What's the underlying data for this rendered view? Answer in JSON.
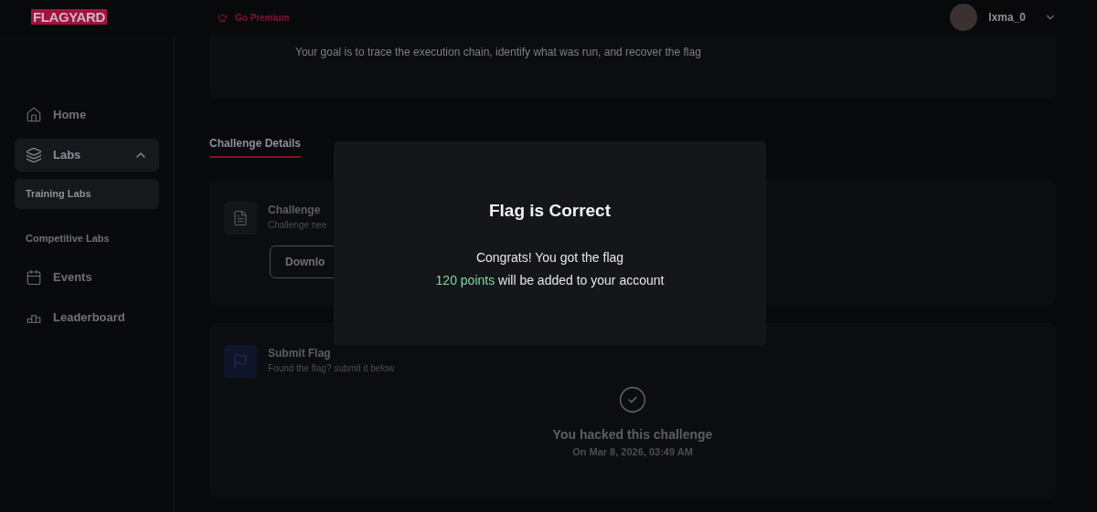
{
  "header": {
    "logo": "FLAGYARD",
    "premium": "Go Premium",
    "user": {
      "name": "lxma_0"
    }
  },
  "sidebar": {
    "items": [
      {
        "kind": "link",
        "label": "Home",
        "selected": false
      },
      {
        "kind": "group",
        "label": "Labs",
        "expanded": true,
        "selected": false,
        "children": [
          {
            "label": "Training Labs",
            "selected": true
          },
          {
            "label": "Competitive Labs",
            "selected": false
          }
        ]
      },
      {
        "kind": "link",
        "label": "Events",
        "selected": false
      },
      {
        "kind": "link",
        "label": "Leaderboard",
        "selected": false
      }
    ]
  },
  "goal": "Your goal is to trace the execution chain, identify what was run, and recover the flag",
  "tabs": [
    {
      "label": "Challenge Details",
      "selected": true
    }
  ],
  "files_card": {
    "title": "Challenge",
    "subtitle": "Challenge nee",
    "button": "Downlo"
  },
  "submit_card": {
    "title": "Submit Flag",
    "subtitle": "Found the flag? submit it below",
    "status": "You hacked this challenge",
    "date": "On Mar 8, 2026, 03:49 AM"
  },
  "modal": {
    "title": "Flag is Correct",
    "line1": "Congrats! You got the flag",
    "points": "120 points",
    "line2": " will be added to your account"
  }
}
